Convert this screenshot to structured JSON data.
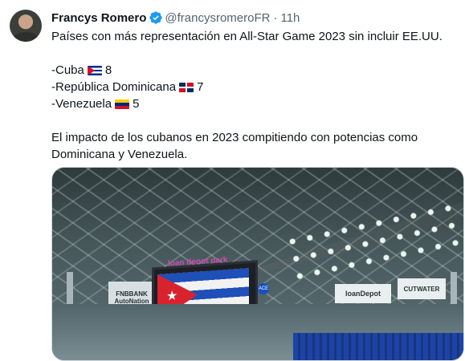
{
  "tweet": {
    "author_name": "Francys Romero",
    "handle": "@francysromeroFR",
    "separator": "·",
    "time": "11h",
    "lines": [
      "Países con más representación en All-Star Game 2023 sin incluir EE.UU.",
      "",
      "-Cuba",
      "-República Dominicana",
      "-Venezuela",
      "",
      "El impacto de los cubanos en 2023 compitiendo con potencias como",
      "Dominicana y Venezuela."
    ],
    "countries": [
      {
        "label": "-Cuba",
        "flag": "flag-cuba",
        "count": "8"
      },
      {
        "label": "-República Dominicana",
        "flag": "flag-dominican-republic",
        "count": "7"
      },
      {
        "label": "-Venezuela",
        "flag": "flag-venezuela",
        "count": "5"
      }
    ]
  },
  "media": {
    "scoreboard_brand": "loan depot park",
    "sign_left_line1": "FNBBANK",
    "sign_left_line2": "AutoNation",
    "sign_center": "loanDepot",
    "sign_right": "CUTWATER",
    "badge": "ACE"
  },
  "colors": {
    "text_primary": "#0f1419",
    "text_secondary": "#536471",
    "verified_blue": "#1d9bf0",
    "border": "#cfd9de"
  },
  "icons": {
    "verified": "verified-badge-icon"
  }
}
